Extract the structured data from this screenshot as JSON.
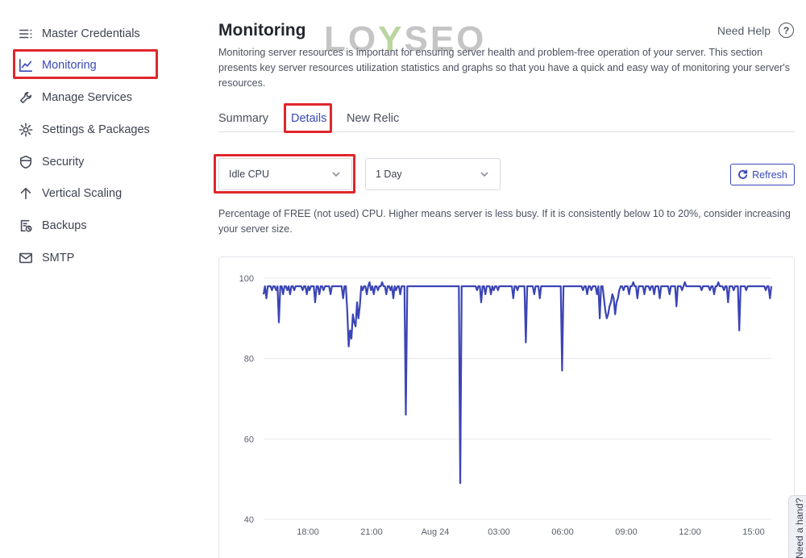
{
  "sidebar": {
    "items": [
      {
        "label": "Master Credentials",
        "icon": "list-menu-icon"
      },
      {
        "label": "Monitoring",
        "icon": "line-chart-icon"
      },
      {
        "label": "Manage Services",
        "icon": "wrench-icon"
      },
      {
        "label": "Settings & Packages",
        "icon": "gear-icon"
      },
      {
        "label": "Security",
        "icon": "shield-icon"
      },
      {
        "label": "Vertical Scaling",
        "icon": "arrow-up-icon"
      },
      {
        "label": "Backups",
        "icon": "backup-icon"
      },
      {
        "label": "SMTP",
        "icon": "mail-icon"
      }
    ],
    "active": "Monitoring"
  },
  "header": {
    "title": "Monitoring",
    "watermark": "LOYSEO",
    "need_help": "Need Help",
    "description": "Monitoring server resources is important for ensuring server health and problem-free operation of your server. This section presents key server resources utilization statistics and graphs so that you have a quick and easy way of monitoring your server's resources."
  },
  "tabs": [
    {
      "label": "Summary"
    },
    {
      "label": "Details"
    },
    {
      "label": "New Relic"
    }
  ],
  "active_tab": "Details",
  "filters": {
    "metric": "Idle CPU",
    "range": "1 Day",
    "refresh_label": "Refresh"
  },
  "metric_description": "Percentage of FREE (not used) CPU. Higher means server is less busy. If it is consistently below 10 to 20%, consider increasing your server size.",
  "help_tab": "Need a hand?",
  "colors": {
    "accent": "#3848b8",
    "highlight": "#e0262c",
    "line": "#3b45b5"
  },
  "chart_data": {
    "type": "line",
    "ylim": [
      40,
      100
    ],
    "yticks": [
      "40",
      "60",
      "80",
      "100"
    ],
    "xticks": [
      "18:00",
      "21:00",
      "Aug 24",
      "03:00",
      "06:00",
      "09:00",
      "12:00",
      "15:00"
    ],
    "series": [
      {
        "values": [
          96,
          98,
          95,
          98,
          98,
          98,
          97,
          98,
          98,
          97,
          98,
          89,
          98,
          98,
          96,
          98,
          98,
          97,
          98,
          96,
          98,
          98,
          97,
          98,
          98,
          98,
          98,
          98,
          97,
          98,
          98,
          96,
          98,
          97,
          98,
          98,
          98,
          94,
          98,
          98,
          96,
          98,
          98,
          97,
          98,
          98,
          98,
          98,
          96,
          98,
          98,
          98,
          98,
          98,
          98,
          98,
          98,
          95,
          98,
          98,
          92,
          83,
          87,
          85,
          91,
          89,
          88,
          94,
          90,
          93,
          98,
          97,
          98,
          98,
          96,
          98,
          99,
          97,
          98,
          96,
          98,
          98,
          97,
          98,
          98,
          99,
          98,
          98,
          96,
          98,
          98,
          97,
          98,
          95,
          98,
          97,
          98,
          98,
          96,
          98,
          98,
          98,
          66,
          98,
          98,
          98,
          98,
          98,
          98,
          98,
          98,
          98,
          98,
          98,
          98,
          98,
          98,
          98,
          98,
          98,
          98,
          98,
          98,
          98,
          98,
          98,
          98,
          98,
          98,
          98,
          98,
          98,
          98,
          98,
          98,
          98,
          98,
          98,
          98,
          98,
          98,
          49,
          98,
          98,
          98,
          98,
          98,
          98,
          98,
          98,
          98,
          98,
          98,
          97,
          98,
          98,
          94,
          98,
          98,
          96,
          98,
          98,
          98,
          96,
          98,
          97,
          98,
          98,
          97,
          98,
          98,
          98,
          98,
          98,
          98,
          98,
          98,
          98,
          98,
          95,
          98,
          98,
          97,
          98,
          98,
          98,
          98,
          98,
          84,
          98,
          98,
          98,
          98,
          98,
          96,
          98,
          98,
          98,
          95,
          98,
          98,
          98,
          98,
          98,
          98,
          98,
          98,
          98,
          98,
          98,
          98,
          98,
          98,
          98,
          77,
          98,
          98,
          98,
          98,
          98,
          98,
          98,
          98,
          98,
          98,
          98,
          98,
          98,
          98,
          97,
          98,
          98,
          96,
          98,
          98,
          97,
          98,
          98,
          98,
          96,
          98,
          90,
          98,
          98,
          95,
          92,
          90,
          91,
          93,
          94,
          96,
          95,
          91,
          94,
          95,
          97,
          98,
          98,
          97,
          98,
          98,
          98,
          96,
          98,
          98,
          99,
          98,
          98,
          95,
          98,
          98,
          98,
          98,
          96,
          98,
          98,
          98,
          97,
          98,
          98,
          96,
          98,
          98,
          98,
          95,
          98,
          98,
          98,
          98,
          98,
          98,
          96,
          98,
          98,
          98,
          98,
          93,
          98,
          98,
          98,
          97,
          98,
          99,
          98,
          98,
          98,
          98,
          98,
          98,
          98,
          98,
          98,
          98,
          98,
          97,
          98,
          98,
          98,
          98,
          98,
          97,
          98,
          98,
          96,
          98,
          98,
          99,
          98,
          98,
          98,
          97,
          98,
          98,
          94,
          98,
          98,
          98,
          97,
          98,
          98,
          98,
          87,
          98,
          98,
          98,
          98,
          97,
          98,
          98,
          98,
          98,
          98,
          98,
          98,
          98,
          98,
          98,
          98,
          98,
          98,
          97,
          98,
          98,
          95,
          98
        ]
      }
    ]
  }
}
